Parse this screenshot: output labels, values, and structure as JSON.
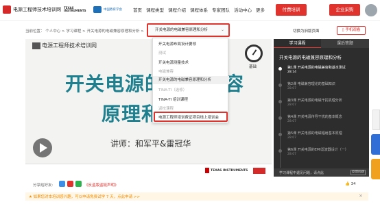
{
  "header": {
    "site_name": "电源工程师技术培训网",
    "ti_logo_text": "TEXAS INSTRUMENTS",
    "partner_text": "中国教育学会",
    "nav": [
      "首页",
      "课程类型",
      "课程介绍",
      "课程体系",
      "专家团队",
      "活动中心",
      "更多"
    ],
    "pay_button": "付费培训",
    "corp_button": "企业采购"
  },
  "breadcrumb": {
    "text": "当前位置： 个人中心 > 学习课程 > 开关电源的电磁兼容原理和分析 >",
    "selected": "开关电源的电磁兼容原理和分析",
    "switch_old": "切换为旧版页面",
    "mobile": "手机观看"
  },
  "dropdown": {
    "items": [
      {
        "type": "opt",
        "label": "开关电源布局设计要领"
      },
      {
        "type": "group",
        "label": "测试"
      },
      {
        "type": "opt",
        "label": "开关电源测量技术"
      },
      {
        "type": "group",
        "label": "电磁兼容"
      },
      {
        "type": "opt",
        "label": "开关电源的电磁兼容原理和分析",
        "active": true
      },
      {
        "type": "group",
        "label": "TINA-TI（选修）"
      },
      {
        "type": "opt",
        "label": "TINA-TI 培训课程"
      },
      {
        "type": "group",
        "label": "返校课程"
      },
      {
        "type": "opt",
        "label": "电源工程师培训费证项目线上培训会"
      }
    ]
  },
  "video": {
    "site_name": "电源工程师技术培训网",
    "title_line1": "开关电源的电磁兼容",
    "title_line2": "原理和分析",
    "speaker": "讲师：和军平&雷冠华",
    "gauge_label": "基础",
    "footer_logo": "TEXAS INSTRUMENTS"
  },
  "right_panel": {
    "tab_study": "学习课程",
    "tab_catalog": "课后答题",
    "course_title": "开关电源的电磁兼容原理和分析",
    "lessons": [
      {
        "title": "第1课 开关电源的电磁兼容和基本测试",
        "duration": "28:14",
        "current": true
      },
      {
        "title": "第2课 电磁兼容理论的基础知识",
        "duration": "28:07",
        "current": false
      },
      {
        "title": "第3课 开关电源的电磁干扰机理分析",
        "duration": "28:07",
        "current": false
      },
      {
        "title": "第4课 开关电源传导干扰的基本概念",
        "duration": "28:07",
        "current": false
      },
      {
        "title": "第5课 开关电源的电磁辐射基本原理",
        "duration": "28:07",
        "current": false
      },
      {
        "title": "第6课 开关电源的EMI滤波器设计（一）",
        "duration": "28:07",
        "current": false
      }
    ],
    "ask_text": "学习课程中遇见问题，请点此",
    "ask_button": "反馈问题"
  },
  "share": {
    "label": "分享给好友:",
    "copyright": "《反盗版盗链声明》",
    "likes": "34"
  },
  "notice": {
    "text": "★ 如果您对本培训感兴趣，可以申请免费试学 7 天，点此申请 >>"
  }
}
